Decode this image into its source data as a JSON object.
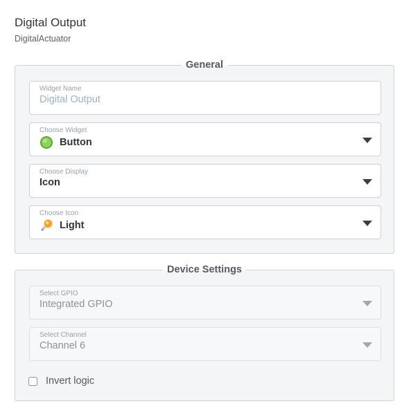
{
  "header": {
    "title": "Digital Output",
    "subtitle": "DigitalActuator"
  },
  "general": {
    "legend": "General",
    "widget_name": {
      "label": "Widget Name",
      "placeholder": "Digital Output",
      "value": ""
    },
    "choose_widget": {
      "label": "Choose Widget",
      "value": "Button",
      "icon": "green-circle-icon"
    },
    "choose_display": {
      "label": "Choose Display",
      "value": "Icon"
    },
    "choose_icon": {
      "label": "Choose Icon",
      "value": "Light",
      "icon": "lightbulb-icon"
    }
  },
  "device": {
    "legend": "Device Settings",
    "select_gpio": {
      "label": "Select GPIO",
      "value": "Integrated GPIO",
      "disabled": true
    },
    "select_channel": {
      "label": "Select Channel",
      "value": "Channel 6",
      "disabled": true
    },
    "invert_logic": {
      "label": "Invert logic",
      "checked": false
    }
  },
  "colors": {
    "accent_green": "#7ec850",
    "bulb_orange": "#f2a33a"
  }
}
